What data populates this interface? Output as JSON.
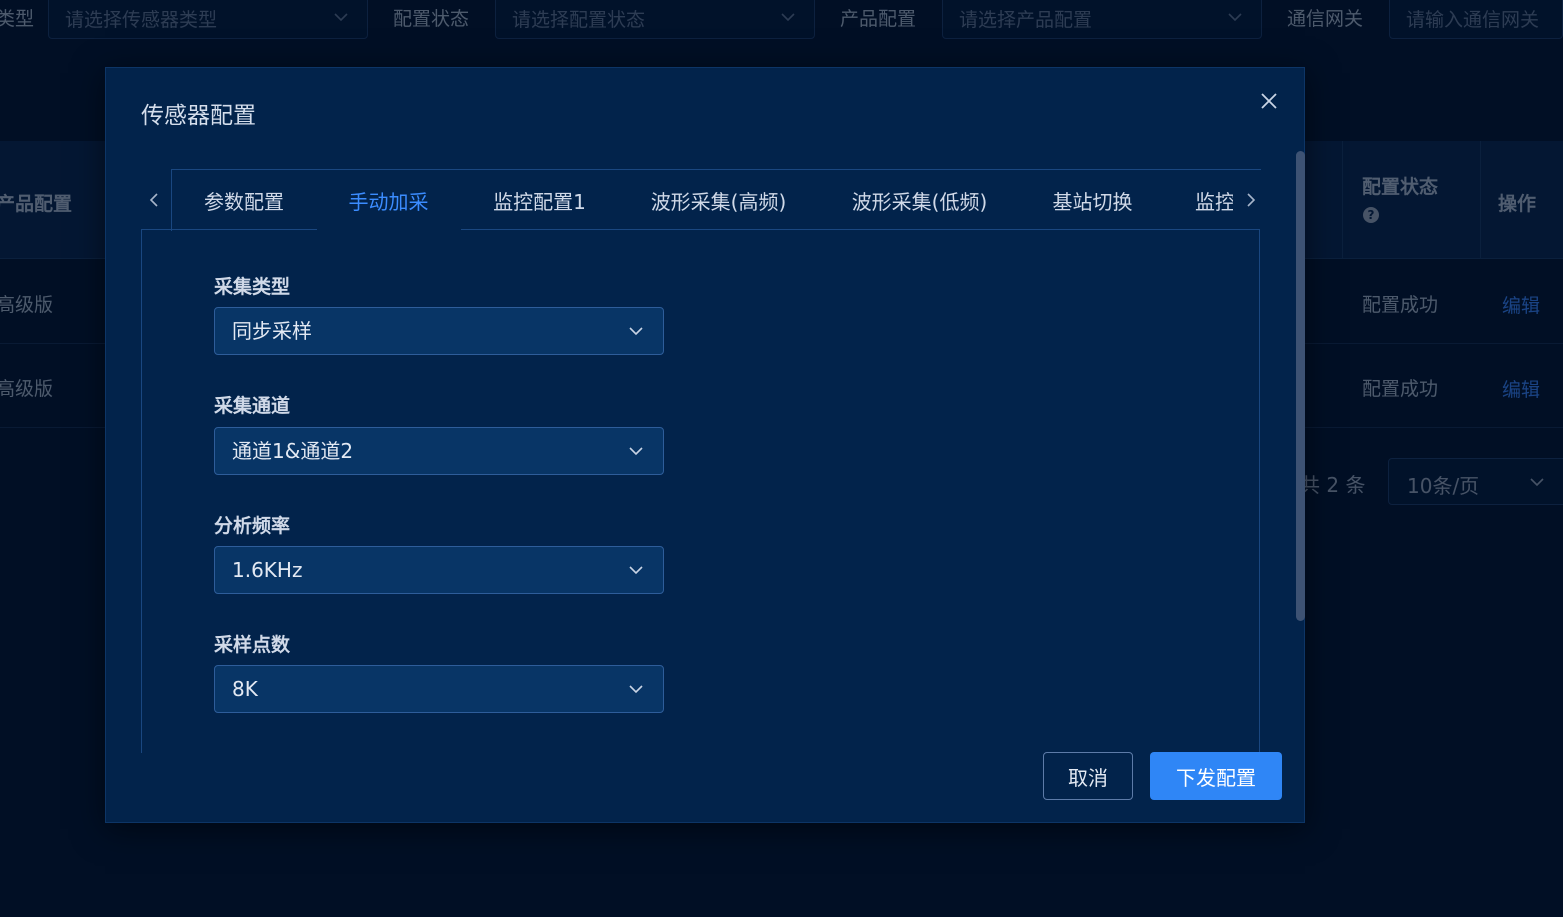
{
  "filters": {
    "sensor_type_label_partial": "类型",
    "sensor_type_placeholder": "请选择传感器类型",
    "config_status_label": "配置状态",
    "config_status_placeholder": "请选择配置状态",
    "product_config_label": "产品配置",
    "product_config_placeholder": "请选择产品配置",
    "gateway_label": "通信网关",
    "gateway_placeholder": "请输入通信网关"
  },
  "table": {
    "headers": {
      "product_config": "产品配置",
      "config_status": "配置状态",
      "config_status_help": "?",
      "actions": "操作"
    },
    "rows": [
      {
        "product_config": "高级版",
        "config_status": "配置成功",
        "action": "编辑"
      },
      {
        "product_config": "高级版",
        "config_status": "配置成功",
        "action": "编辑"
      }
    ],
    "pagination": {
      "total_text": "共 2 条",
      "page_size": "10条/页"
    }
  },
  "modal": {
    "title": "传感器配置",
    "tabs": [
      {
        "label": "参数配置",
        "active": false
      },
      {
        "label": "手动加采",
        "active": true
      },
      {
        "label": "监控配置1",
        "active": false
      },
      {
        "label": "波形采集(高频)",
        "active": false
      },
      {
        "label": "波形采集(低频)",
        "active": false
      },
      {
        "label": "基站切换",
        "active": false
      },
      {
        "label": "监控",
        "active": false
      }
    ],
    "fields": [
      {
        "label": "采集类型",
        "value": "同步采样"
      },
      {
        "label": "采集通道",
        "value": "通道1&通道2"
      },
      {
        "label": "分析频率",
        "value": "1.6KHz"
      },
      {
        "label": "采样点数",
        "value": "8K"
      }
    ],
    "buttons": {
      "cancel": "取消",
      "submit": "下发配置"
    }
  },
  "colors": {
    "background": "#021633",
    "modal_bg": "#02234b",
    "accent": "#2f86f6",
    "active_tab": "#3b8cff",
    "link": "#2e6fd6"
  }
}
